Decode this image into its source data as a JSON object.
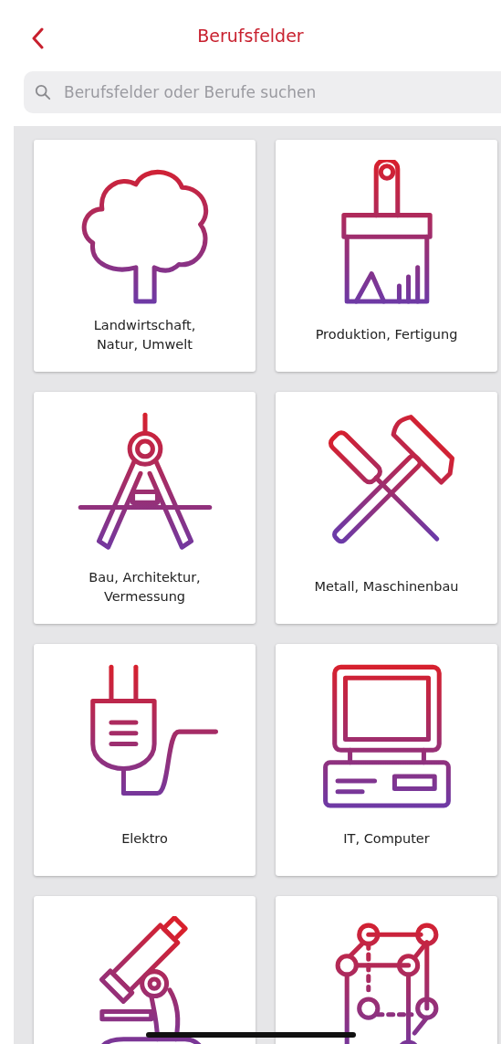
{
  "header": {
    "title": "Berufsfelder"
  },
  "search": {
    "placeholder": "Berufsfelder oder Berufe suchen"
  },
  "cards": [
    {
      "kind": "tree",
      "label": "Landwirtschaft,\nNatur, Umwelt"
    },
    {
      "kind": "brush",
      "label": "Produktion, Fertigung"
    },
    {
      "kind": "compass",
      "label": "Bau, Architektur,\nVermessung"
    },
    {
      "kind": "tools",
      "label": "Metall, Maschinenbau"
    },
    {
      "kind": "plug",
      "label": "Elektro"
    },
    {
      "kind": "computer",
      "label": "IT, Computer"
    },
    {
      "kind": "microscope"
    },
    {
      "kind": "lattice"
    }
  ]
}
